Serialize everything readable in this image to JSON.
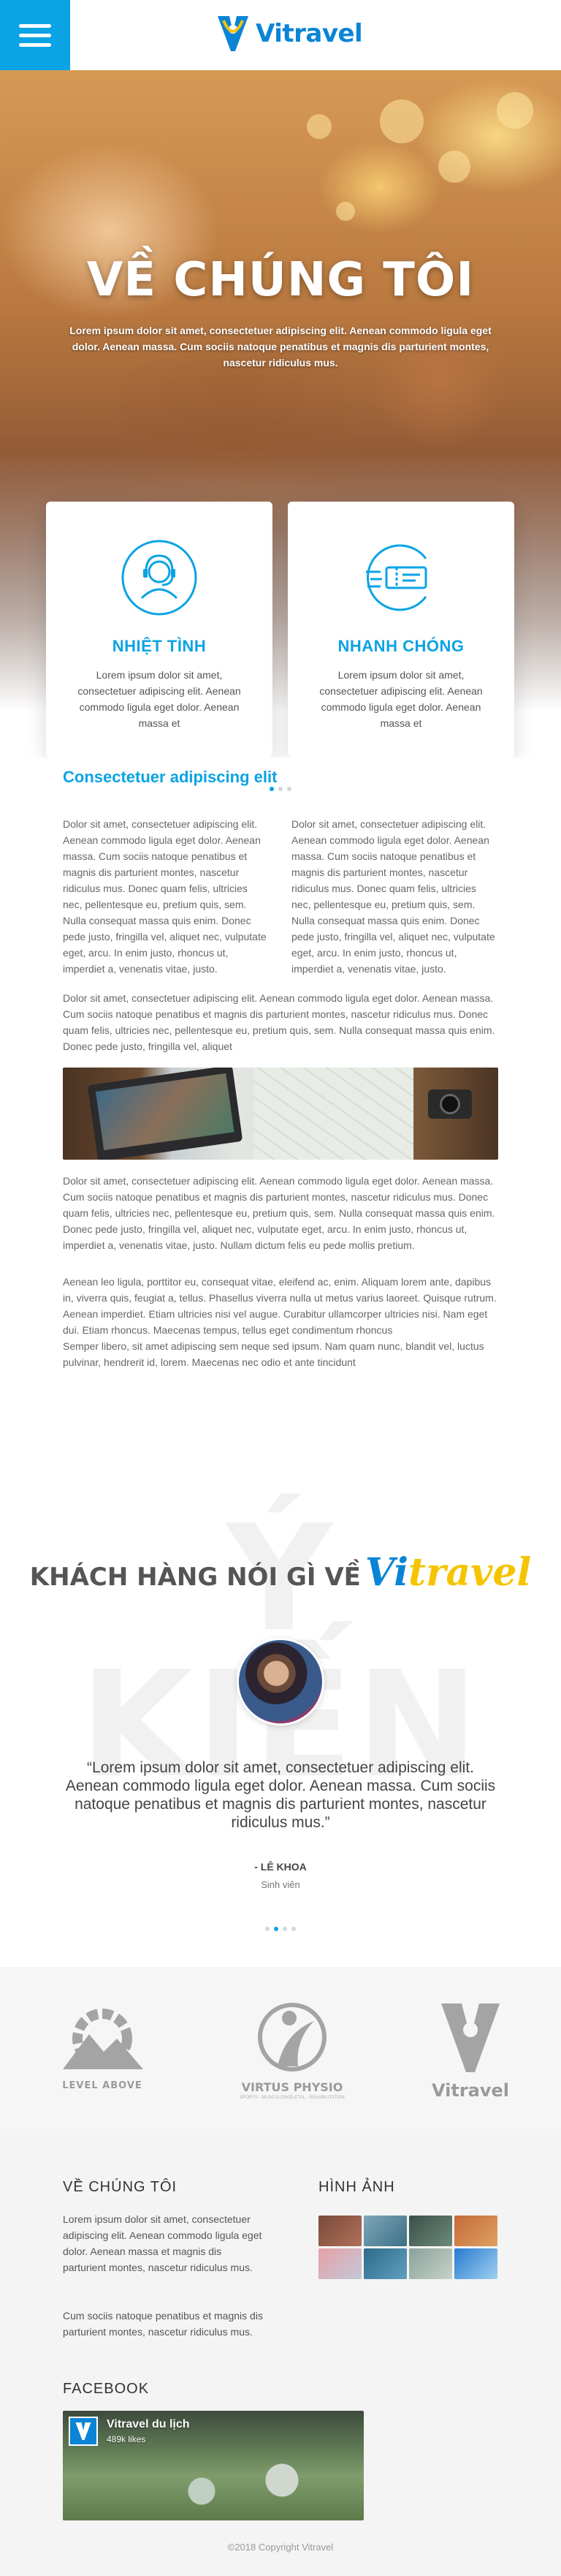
{
  "header": {
    "logo_text": "Vitravel",
    "menu_icon": "hamburger-menu-icon"
  },
  "hero": {
    "title": "VỀ CHÚNG TÔI",
    "text": "Lorem ipsum dolor sit amet, consectetuer adipiscing elit. Aenean commodo ligula eget dolor. Aenean massa. Cum sociis natoque penatibus et magnis dis parturient montes, nascetur ridiculus mus."
  },
  "features": [
    {
      "icon": "headset-support-icon",
      "title": "NHIỆT TÌNH",
      "desc": "Lorem ipsum dolor sit amet, consectetuer adipiscing elit. Aenean commodo ligula eget dolor. Aenean massa et"
    },
    {
      "icon": "fast-ticket-icon",
      "title": "NHANH CHÓNG",
      "desc": "Lorem ipsum dolor sit amet, consectetuer adipiscing elit. Aenean commodo ligula eget dolor. Aenean massa et"
    }
  ],
  "article": {
    "heading": "Consectetuer adipiscing elit",
    "col1": "Dolor sit amet, consectetuer adipiscing elit. Aenean commodo ligula eget dolor. Aenean massa. Cum sociis natoque penatibus et magnis dis parturient montes, nascetur ridiculus mus. Donec quam felis, ultricies nec, pellentesque eu, pretium quis, sem. Nulla consequat massa quis enim. Donec pede justo, fringilla vel, aliquet nec, vulputate eget, arcu. In enim justo, rhoncus ut, imperdiet a, venenatis vitae, justo.",
    "col2": "Dolor sit amet, consectetuer adipiscing elit. Aenean commodo ligula eget dolor. Aenean massa. Cum sociis natoque penatibus et magnis dis parturient montes, nascetur ridiculus mus. Donec quam felis, ultricies nec, pellentesque eu, pretium quis, sem. Nulla consequat massa quis enim. Donec pede justo, fringilla vel, aliquet nec, vulputate eget, arcu. In enim justo, rhoncus ut, imperdiet a, venenatis vitae, justo.",
    "para1": "Dolor sit amet, consectetuer adipiscing elit. Aenean commodo ligula eget dolor. Aenean massa. Cum sociis natoque penatibus et magnis dis parturient montes, nascetur ridiculus mus. Donec quam felis, ultricies nec, pellentesque eu, pretium quis, sem. Nulla consequat massa quis enim. Donec pede justo, fringilla vel, aliquet",
    "para2": "Dolor sit amet, consectetuer adipiscing elit. Aenean commodo ligula eget dolor. Aenean massa. Cum sociis natoque penatibus et magnis dis parturient montes, nascetur ridiculus mus. Donec quam felis, ultricies nec, pellentesque eu, pretium quis, sem. Nulla consequat massa quis enim. Donec pede justo, fringilla vel, aliquet nec, vulputate eget, arcu. In enim justo, rhoncus ut, imperdiet a, venenatis vitae, justo. Nullam dictum felis eu pede mollis pretium.",
    "para3": "Aenean leo ligula, porttitor eu, consequat vitae, eleifend ac, enim. Aliquam lorem ante, dapibus in, viverra quis, feugiat a, tellus. Phasellus viverra nulla ut metus varius laoreet. Quisque rutrum. Aenean imperdiet. Etiam ultricies nisi vel augue. Curabitur ullamcorper ultricies nisi. Nam eget dui. Etiam rhoncus. Maecenas tempus, tellus eget condimentum rhoncus",
    "para4": "Semper libero, sit amet adipiscing sem neque sed ipsum. Nam quam nunc, blandit vel, luctus pulvinar, hendrerit id, lorem. Maecenas nec odio et ante tincidunt"
  },
  "testimonials": {
    "watermark": "Ý KIẾN",
    "title": "KHÁCH HÀNG NÓI GÌ VỀ",
    "brand_vi": "Vi",
    "brand_rest": "travel",
    "quote": "“Lorem ipsum dolor sit amet, consectetuer adipiscing elit. Aenean commodo ligula eget dolor. Aenean massa. Cum sociis natoque penatibus et magnis dis parturient montes, nascetur ridiculus mus.”",
    "author": "- LÊ KHOA",
    "role": "Sinh viên"
  },
  "partners": {
    "p1_name": "LEVEL ABOVE",
    "p2_name": "VIRTUS PHYSIO",
    "p2_tagline": "SPORTS · MUSCULOSKELETAL · REHABILITATION",
    "p3_name": "Vitravel"
  },
  "footer": {
    "about_heading": "VỀ CHÚNG TÔI",
    "about_p1": "Lorem ipsum dolor sit amet, consectetuer adipiscing elit. Aenean commodo ligula eget dolor. Aenean massa et magnis dis parturient montes, nascetur ridiculus mus.",
    "about_p2": "Cum sociis natoque penatibus et magnis dis parturient montes, nascetur ridiculus mus.",
    "gallery_heading": "HÌNH ẢNH",
    "facebook_heading": "FACEBOOK",
    "fb_page_name": "Vitravel du lịch",
    "fb_likes": "489k likes",
    "copyright": "©2018 Copyright Vitravel"
  },
  "colors": {
    "accent": "#0aa3e4",
    "brand_blue": "#0a84d6",
    "brand_yellow": "#f5c400"
  }
}
